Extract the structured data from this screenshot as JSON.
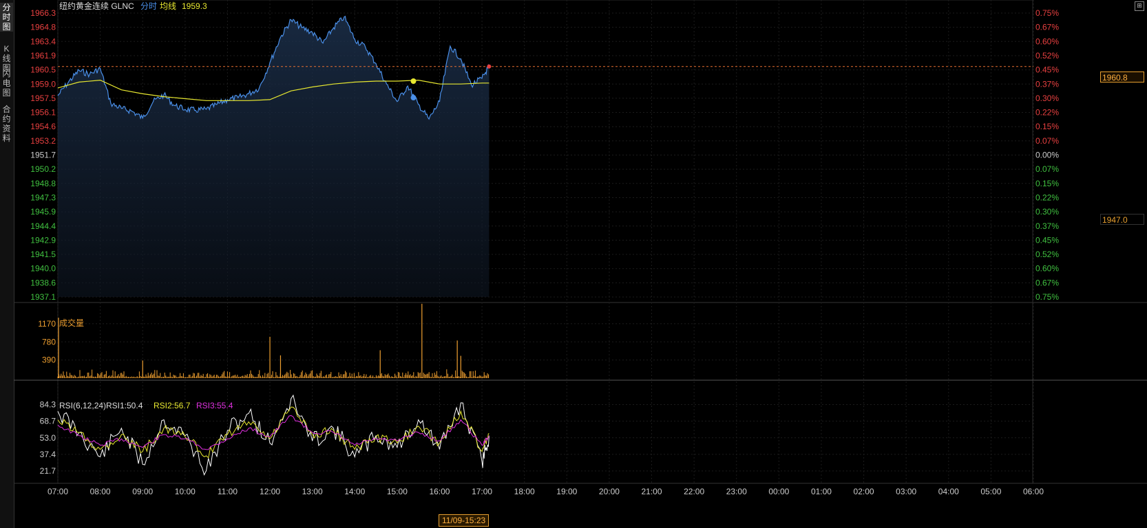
{
  "sidebar": {
    "tabs": [
      {
        "label": "分时图",
        "active": true
      },
      {
        "label": "K线图",
        "active": false
      },
      {
        "label": "闪电图",
        "active": false
      },
      {
        "label": "合约资料",
        "active": false
      }
    ]
  },
  "header": {
    "instrument": "纽约黄金连续",
    "code": "GLNC",
    "mode": "分时",
    "avg_label": "均线",
    "avg_value": "1959.3"
  },
  "volume_panel": {
    "title": "成交量"
  },
  "rsi_panel": {
    "title": "RSI(6,12,24)",
    "rsi1": "RSI1:50.4",
    "rsi2": "RSI2:56.7",
    "rsi3": "RSI3:55.4"
  },
  "tags": {
    "last_price": "1960.8",
    "cross_price": "1947.0",
    "cross_time": "11/09-15:23"
  },
  "colors": {
    "price_line": "#4a8fe8",
    "avg_line": "#e8e830",
    "volume": "#f0a030",
    "rsi1": "#ffffff",
    "rsi2": "#e8e830",
    "rsi3": "#e030e0",
    "up": "#e84040",
    "down": "#40c040",
    "flat": "#cccccc"
  },
  "chart_data": [
    {
      "type": "line",
      "panel": "price",
      "y_ticks": [
        "1966.3",
        "1964.8",
        "1963.4",
        "1961.9",
        "1960.5",
        "1959.0",
        "1957.5",
        "1956.1",
        "1954.6",
        "1953.2",
        "1951.7",
        "1950.2",
        "1948.8",
        "1947.3",
        "1945.9",
        "1944.4",
        "1942.9",
        "1941.5",
        "1940.0",
        "1938.6",
        "1937.1"
      ],
      "pct_ticks": [
        "0.75%",
        "0.67%",
        "0.60%",
        "0.52%",
        "0.45%",
        "0.37%",
        "0.30%",
        "0.22%",
        "0.15%",
        "0.07%",
        "0.00%",
        "0.07%",
        "0.15%",
        "0.22%",
        "0.30%",
        "0.37%",
        "0.45%",
        "0.52%",
        "0.60%",
        "0.67%",
        "0.75%"
      ],
      "ylim": [
        1937.1,
        1966.3
      ],
      "x_ticks": [
        "07:00",
        "08:00",
        "09:00",
        "10:00",
        "11:00",
        "12:00",
        "13:00",
        "14:00",
        "15:00",
        "16:00",
        "17:00",
        "18:00",
        "19:00",
        "20:00",
        "21:00",
        "22:00",
        "23:00",
        "00:00",
        "01:00",
        "02:00",
        "03:00",
        "04:00",
        "05:00",
        "06:00"
      ],
      "series": [
        {
          "role": "price",
          "x": [
            "07:00",
            "07:15",
            "07:30",
            "07:45",
            "08:00",
            "08:15",
            "08:30",
            "08:45",
            "09:00",
            "09:15",
            "09:30",
            "09:45",
            "10:00",
            "10:15",
            "10:30",
            "10:45",
            "11:00",
            "11:15",
            "11:30",
            "11:45",
            "12:00",
            "12:15",
            "12:30",
            "12:45",
            "13:00",
            "13:15",
            "13:30",
            "13:45",
            "14:00",
            "14:15",
            "14:30",
            "14:45",
            "15:00",
            "15:15",
            "15:30",
            "15:45",
            "16:00",
            "16:15",
            "16:30",
            "16:45",
            "17:00",
            "17:10"
          ],
          "values": [
            1957.8,
            1959.2,
            1960.4,
            1960.0,
            1960.6,
            1957.0,
            1956.5,
            1956.2,
            1955.5,
            1957.2,
            1957.9,
            1956.8,
            1956.4,
            1956.3,
            1956.4,
            1956.9,
            1957.4,
            1957.6,
            1958.0,
            1958.6,
            1961.2,
            1963.8,
            1965.6,
            1964.8,
            1964.3,
            1963.2,
            1964.8,
            1965.9,
            1963.6,
            1962.8,
            1961.1,
            1959.0,
            1957.2,
            1958.8,
            1956.9,
            1955.4,
            1957.2,
            1962.9,
            1961.6,
            1958.9,
            1959.6,
            1960.8
          ]
        },
        {
          "role": "average",
          "x": [
            "07:00",
            "07:30",
            "08:00",
            "08:30",
            "09:00",
            "09:30",
            "10:00",
            "10:30",
            "11:00",
            "11:30",
            "12:00",
            "12:30",
            "13:00",
            "13:30",
            "14:00",
            "14:30",
            "15:00",
            "15:30",
            "16:00",
            "16:30",
            "17:00",
            "17:10"
          ],
          "values": [
            1958.6,
            1959.2,
            1959.4,
            1958.4,
            1958.0,
            1957.7,
            1957.5,
            1957.3,
            1957.3,
            1957.3,
            1957.4,
            1958.3,
            1958.7,
            1959.0,
            1959.2,
            1959.3,
            1959.3,
            1959.4,
            1959.0,
            1959.0,
            1959.1,
            1959.1
          ]
        }
      ],
      "markers": [
        {
          "x": "15:23",
          "value": 1959.3,
          "series": "average"
        },
        {
          "x": "15:23",
          "value": 1957.6,
          "series": "price"
        }
      ],
      "last_value": 1960.8,
      "crosshair_value": 1947.0
    },
    {
      "type": "bar",
      "panel": "volume",
      "y_ticks": [
        "1170",
        "780",
        "390"
      ],
      "ylim": [
        0,
        1450
      ],
      "spikes": [
        {
          "x": "07:01",
          "value": 1300
        },
        {
          "x": "12:00",
          "value": 890
        },
        {
          "x": "12:15",
          "value": 490
        },
        {
          "x": "14:36",
          "value": 600
        },
        {
          "x": "15:35",
          "value": 1600
        },
        {
          "x": "16:25",
          "value": 810
        },
        {
          "x": "16:30",
          "value": 480
        },
        {
          "x": "09:00",
          "value": 380
        }
      ],
      "baseline_range": [
        20,
        200
      ]
    },
    {
      "type": "line",
      "panel": "rsi",
      "y_ticks": [
        "84.3",
        "68.7",
        "53.0",
        "37.4",
        "21.7"
      ],
      "ylim": [
        12,
        95
      ],
      "series": [
        {
          "name": "RSI1",
          "x": [
            "07:00",
            "07:30",
            "08:00",
            "08:30",
            "09:00",
            "09:30",
            "10:00",
            "10:30",
            "11:00",
            "11:30",
            "12:00",
            "12:30",
            "13:00",
            "13:30",
            "14:00",
            "14:30",
            "15:00",
            "15:30",
            "16:00",
            "16:30",
            "17:00",
            "17:10"
          ],
          "values": [
            78,
            58,
            35,
            62,
            28,
            70,
            55,
            22,
            60,
            76,
            48,
            90,
            50,
            62,
            35,
            55,
            44,
            70,
            42,
            86,
            30,
            55
          ]
        },
        {
          "name": "RSI2",
          "x": [
            "07:00",
            "07:30",
            "08:00",
            "08:30",
            "09:00",
            "09:30",
            "10:00",
            "10:30",
            "11:00",
            "11:30",
            "12:00",
            "12:30",
            "13:00",
            "13:30",
            "14:00",
            "14:30",
            "15:00",
            "15:30",
            "16:00",
            "16:30",
            "17:00",
            "17:10"
          ],
          "values": [
            70,
            58,
            42,
            56,
            40,
            62,
            54,
            36,
            56,
            68,
            52,
            82,
            56,
            60,
            42,
            54,
            48,
            64,
            48,
            78,
            40,
            57
          ]
        },
        {
          "name": "RSI3",
          "x": [
            "07:00",
            "07:30",
            "08:00",
            "08:30",
            "09:00",
            "09:30",
            "10:00",
            "10:30",
            "11:00",
            "11:30",
            "12:00",
            "12:30",
            "13:00",
            "13:30",
            "14:00",
            "14:30",
            "15:00",
            "15:30",
            "16:00",
            "16:30",
            "17:00",
            "17:10"
          ],
          "values": [
            65,
            55,
            46,
            52,
            44,
            56,
            52,
            42,
            52,
            62,
            54,
            74,
            58,
            58,
            46,
            52,
            50,
            58,
            50,
            70,
            46,
            55
          ]
        }
      ]
    }
  ]
}
